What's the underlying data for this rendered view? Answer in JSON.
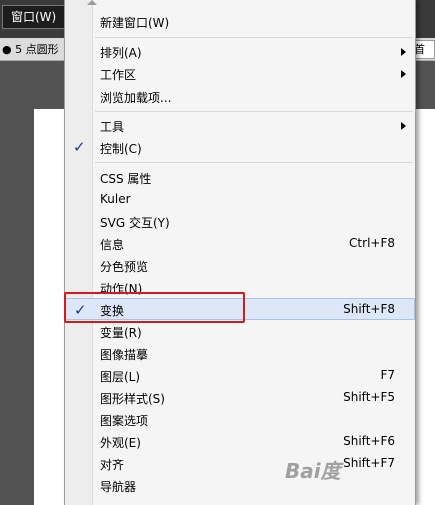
{
  "menubar": {
    "window_label": "窗口(W)"
  },
  "controlbar": {
    "left_text": "● 5 点圆形",
    "right_text": "首选"
  },
  "menu": {
    "items": [
      {
        "label": "新建窗口(W)"
      },
      {
        "label": "排列(A)"
      },
      {
        "label": "工作区"
      },
      {
        "label": "浏览加载项..."
      },
      {
        "label": "工具"
      },
      {
        "label": "控制(C)"
      },
      {
        "label": "CSS 属性"
      },
      {
        "label": "Kuler"
      },
      {
        "label": "SVG 交互(Y)"
      },
      {
        "label": "信息",
        "shortcut": "Ctrl+F8"
      },
      {
        "label": "分色预览"
      },
      {
        "label": "动作(N)"
      },
      {
        "label": "变换",
        "shortcut": "Shift+F8"
      },
      {
        "label": "变量(R)"
      },
      {
        "label": "图像描摹"
      },
      {
        "label": "图层(L)",
        "shortcut": "F7"
      },
      {
        "label": "图形样式(S)",
        "shortcut": "Shift+F5"
      },
      {
        "label": "图案选项"
      },
      {
        "label": "外观(E)",
        "shortcut": "Shift+F6"
      },
      {
        "label": "对齐",
        "shortcut": "Shift+F7"
      },
      {
        "label": "导航器"
      }
    ],
    "checked": [
      "控制(C)",
      "变换"
    ]
  },
  "watermark": "Bai度"
}
